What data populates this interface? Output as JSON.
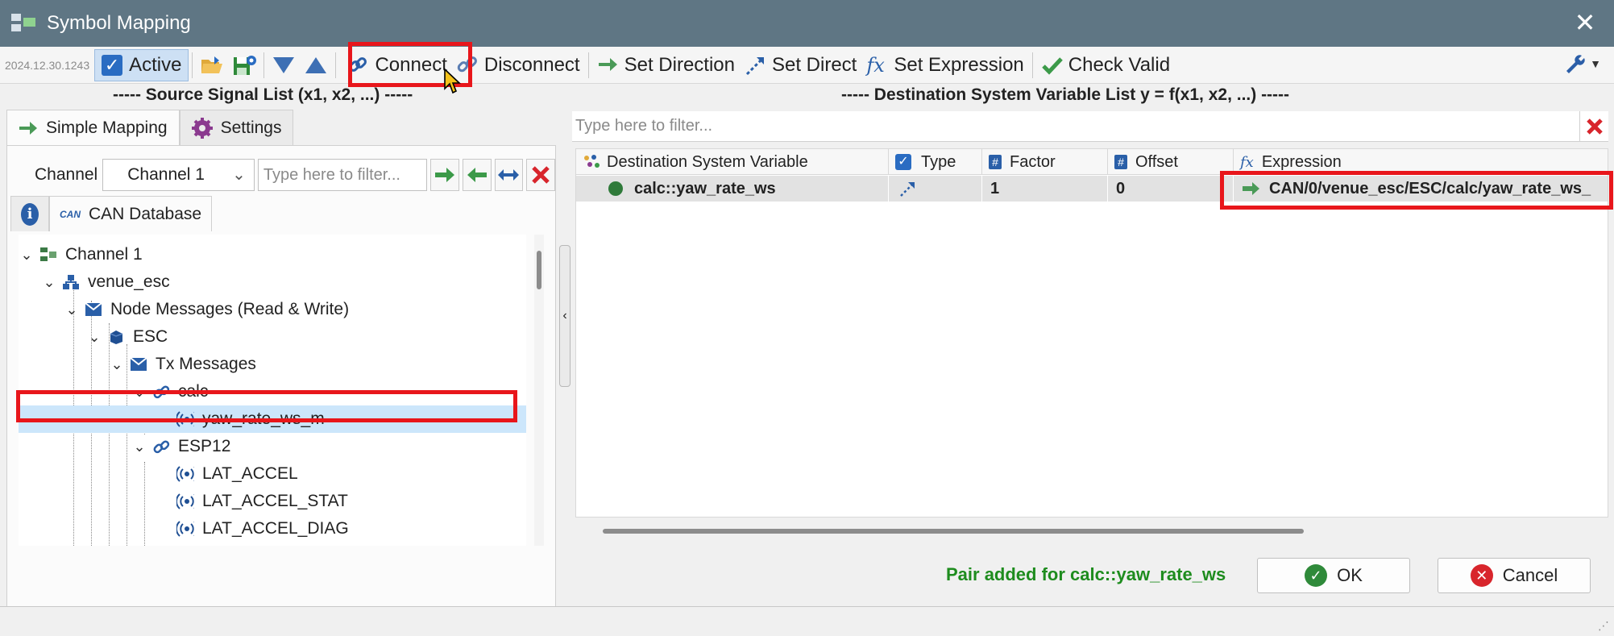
{
  "window": {
    "title": "Symbol Mapping",
    "close_glyph": "✕"
  },
  "toolbar": {
    "version": "2024.12.30.1243",
    "active_label": "Active",
    "connect_label": "Connect",
    "disconnect_label": "Disconnect",
    "set_direction_label": "Set Direction",
    "set_direct_label": "Set Direct",
    "set_expression_label": "Set Expression",
    "check_valid_label": "Check Valid"
  },
  "source": {
    "header": "----- Source Signal List (x1, x2, ...) -----",
    "tabs": [
      {
        "label": "Simple Mapping"
      },
      {
        "label": "Settings"
      }
    ],
    "channel_label": "Channel",
    "channel_value": "Channel 1",
    "filter_placeholder": "Type here to filter...",
    "subtabs": [
      {
        "label": "i"
      },
      {
        "label": "CAN Database",
        "logo": "CAN"
      }
    ],
    "tree": [
      {
        "label": "Channel 1",
        "icon": "channel-icon"
      },
      {
        "label": "venue_esc",
        "icon": "network-icon"
      },
      {
        "label": "Node Messages (Read & Write)",
        "icon": "envelope-icon"
      },
      {
        "label": "ESC",
        "icon": "node-cube-icon"
      },
      {
        "label": "Tx Messages",
        "icon": "envelope-icon"
      },
      {
        "label": "calc",
        "icon": "link-icon"
      },
      {
        "label": "yaw_rate_ws_m",
        "icon": "signal-icon"
      },
      {
        "label": "ESP12",
        "icon": "link-icon"
      },
      {
        "label": "LAT_ACCEL",
        "icon": "signal-icon"
      },
      {
        "label": "LAT_ACCEL_STAT",
        "icon": "signal-icon"
      },
      {
        "label": "LAT_ACCEL_DIAG",
        "icon": "signal-icon"
      }
    ]
  },
  "destination": {
    "header": "----- Destination System Variable List y = f(x1, x2, ...) -----",
    "filter_placeholder": "Type here to filter...",
    "columns": [
      "Destination System Variable",
      "Type",
      "Factor",
      "Offset",
      "Expression"
    ],
    "rows": [
      {
        "variable": "calc::yaw_rate_ws",
        "factor": "1",
        "offset": "0",
        "expression": "CAN/0/venue_esc/ESC/calc/yaw_rate_ws_"
      }
    ]
  },
  "footer": {
    "status": "Pair added for calc::yaw_rate_ws",
    "ok_label": "OK",
    "cancel_label": "Cancel"
  },
  "colors": {
    "titlebar": "#5f7684",
    "accent_blue": "#2a5fa8",
    "highlight_red": "#e8161b",
    "status_green": "#1e8c1e",
    "selection": "#cce6fb"
  }
}
